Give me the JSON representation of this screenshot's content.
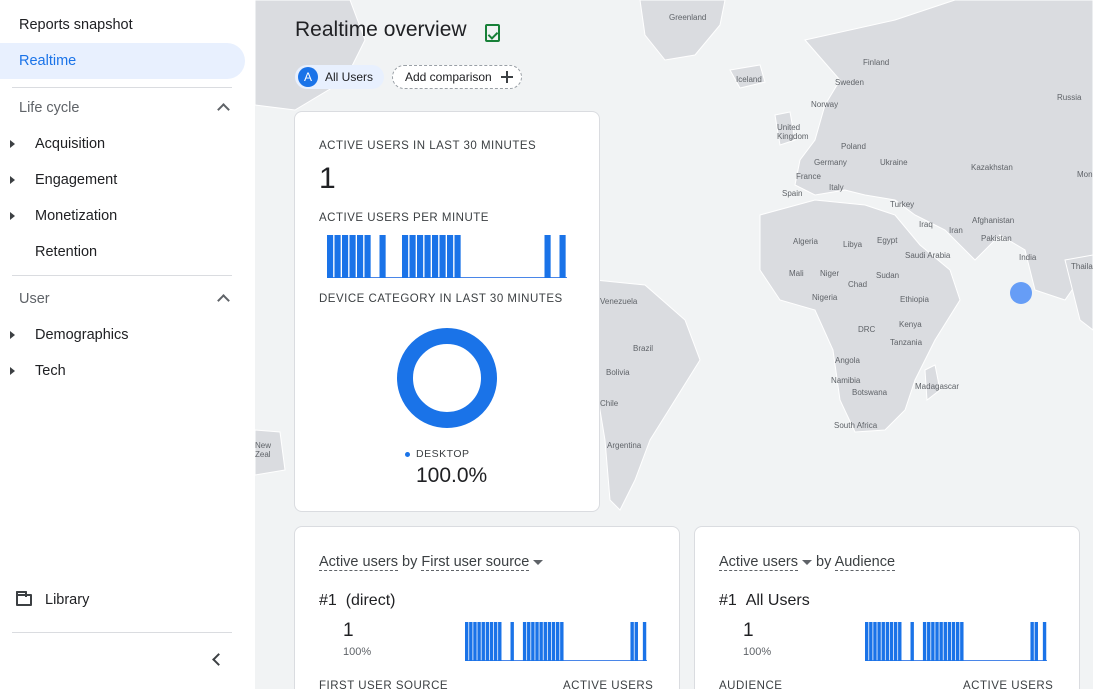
{
  "sidebar": {
    "reports_snapshot": "Reports snapshot",
    "realtime": "Realtime",
    "lifecycle": {
      "label": "Life cycle",
      "items": [
        "Acquisition",
        "Engagement",
        "Monetization",
        "Retention"
      ]
    },
    "user": {
      "label": "User",
      "items": [
        "Demographics",
        "Tech"
      ]
    },
    "library": "Library"
  },
  "header": {
    "title": "Realtime overview",
    "chip_avatar": "A",
    "chip_users": "All Users",
    "add_comparison": "Add comparison"
  },
  "map": {
    "countries": [
      "Greenland",
      "Finland",
      "Iceland",
      "Sweden",
      "Russia",
      "Norway",
      "United Kingdom",
      "Poland",
      "Germany",
      "Ukraine",
      "Kazakhstan",
      "France",
      "Mongolia",
      "Italy",
      "Spain",
      "Turkey",
      "Iraq",
      "Iran",
      "Afghanistan",
      "Algeria",
      "Libya",
      "Egypt",
      "Pakistan",
      "Saudi Arabia",
      "India",
      "Thailand",
      "Mali",
      "Niger",
      "Sudan",
      "Chad",
      "Nigeria",
      "Ethiopia",
      "Venezuela",
      "Kenya",
      "DRC",
      "Tanzania",
      "Brazil",
      "Bolivia",
      "Angola",
      "Namibia",
      "Madagascar",
      "Botswana",
      "Chile",
      "Argentina",
      "South Africa",
      "New Zealand"
    ]
  },
  "main_card": {
    "active_users_label": "ACTIVE USERS IN LAST 30 MINUTES",
    "active_users_value": "1",
    "per_minute_label": "ACTIVE USERS PER MINUTE",
    "per_minute_values": [
      1,
      1,
      1,
      1,
      1,
      1,
      0,
      1,
      0,
      0,
      1,
      1,
      1,
      1,
      1,
      1,
      1,
      1,
      0,
      0,
      0,
      0,
      0,
      0,
      0,
      0,
      0,
      0,
      0,
      1,
      0,
      1
    ],
    "device_label": "DEVICE CATEGORY IN LAST 30 MINUTES",
    "device_legend": "DESKTOP",
    "device_pct": "100.0%",
    "device_share": 1.0
  },
  "source_card": {
    "title_prefix": "Active users",
    "title_mid": " by ",
    "title_dim": "First user source",
    "rank": "#1",
    "rank_label": "(direct)",
    "value": "1",
    "pct": "100%",
    "col_left": "FIRST USER SOURCE",
    "col_right": "ACTIVE USERS",
    "spark_values": [
      1,
      1,
      1,
      1,
      1,
      1,
      1,
      1,
      1,
      0,
      0,
      1,
      0,
      0,
      1,
      1,
      1,
      1,
      1,
      1,
      1,
      1,
      1,
      1,
      0,
      0,
      0,
      0,
      0,
      0,
      0,
      0,
      0,
      0,
      0,
      0,
      0,
      0,
      0,
      0,
      1,
      1,
      0,
      1
    ]
  },
  "audience_card": {
    "title_prefix": "Active users",
    "title_mid": " by ",
    "title_dim": "Audience",
    "rank": "#1",
    "rank_label": "All Users",
    "value": "1",
    "pct": "100%",
    "col_left": "AUDIENCE",
    "col_right": "ACTIVE USERS",
    "spark_values": [
      1,
      1,
      1,
      1,
      1,
      1,
      1,
      1,
      1,
      0,
      0,
      1,
      0,
      0,
      1,
      1,
      1,
      1,
      1,
      1,
      1,
      1,
      1,
      1,
      0,
      0,
      0,
      0,
      0,
      0,
      0,
      0,
      0,
      0,
      0,
      0,
      0,
      0,
      0,
      0,
      1,
      1,
      0,
      1
    ]
  },
  "colors": {
    "accent": "#1a73e8",
    "map_land": "#dadce0",
    "map_water": "#f1f3f4"
  }
}
